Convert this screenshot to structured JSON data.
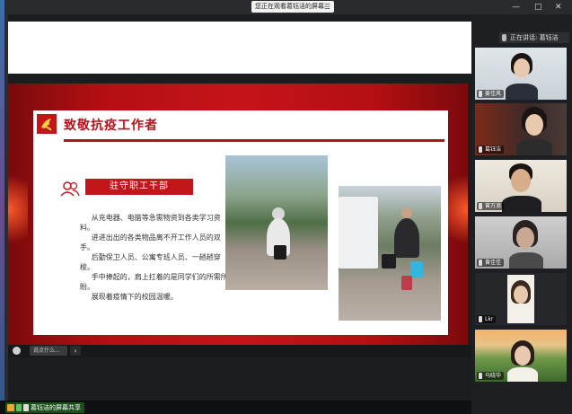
{
  "top": {
    "share_title": "您正在观看葛钰洁的屏幕",
    "menu_icon": "menu-icon",
    "window_controls": [
      "—",
      "□",
      "✕"
    ]
  },
  "slide": {
    "title": "致敬抗疫工作者",
    "badge": "驻守职工干部",
    "paragraphs": [
      "从充电器、电脑等急需物资到各类学习资料。",
      "进进出出的各类物品离不开工作人员的双手。",
      "后勤保卫人员、公寓专班人员、一趟趟穿梭。",
      "手中捧起的，肩上扛着的是同学们的所需所盼。",
      "展现着疫情下的校园温暖。"
    ],
    "accent": "#b5121b"
  },
  "chat": {
    "placeholder": "说点什么...",
    "arrow": "‹"
  },
  "sidebar": {
    "speaker_label": "正在讲话: 葛钰洁",
    "participants": [
      {
        "name": "姜佳风"
      },
      {
        "name": "葛钰洁"
      },
      {
        "name": "曾万浪"
      },
      {
        "name": "黄佳佳"
      },
      {
        "name": "Lkr"
      },
      {
        "name": "马晓华"
      }
    ]
  },
  "bottom": {
    "share_label": "葛钰洁的屏幕共享"
  }
}
